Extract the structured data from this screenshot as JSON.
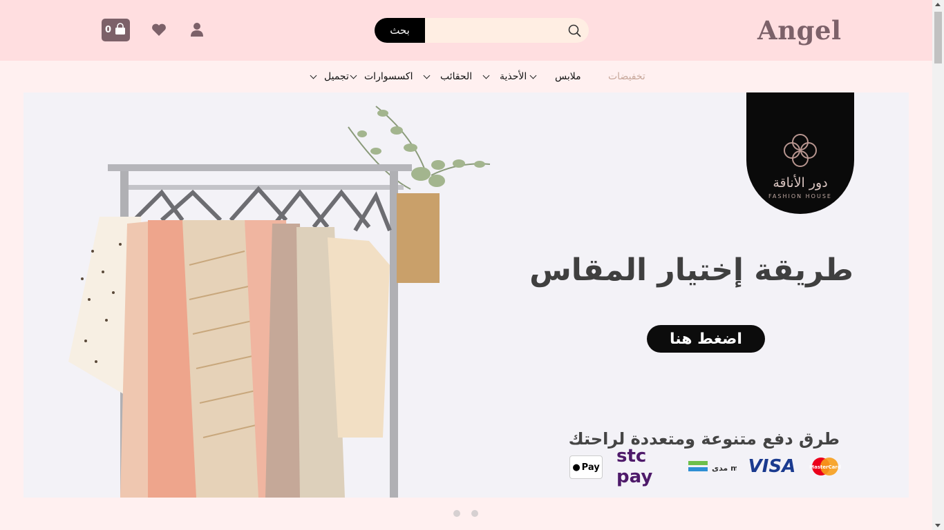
{
  "header": {
    "logo": "Angel",
    "search_button": "بحث",
    "search_placeholder": "",
    "cart_count": "0"
  },
  "nav": {
    "items": [
      {
        "label": "تخفيضات",
        "has_dropdown": false
      },
      {
        "label": "ملابس",
        "has_dropdown": true
      },
      {
        "label": "الأحذية",
        "has_dropdown": true
      },
      {
        "label": "الحقائب",
        "has_dropdown": true
      },
      {
        "label": "اكسسوارات",
        "has_dropdown": true
      },
      {
        "label": "تجميل",
        "has_dropdown": true
      }
    ]
  },
  "banner": {
    "brand_ar": "دور الأناقة",
    "brand_en": "FASHION HOUSE",
    "headline": "طريقة إختيار المقاس",
    "cta": "اضغط هنا",
    "payment_title": "طرق دفع متنوعة ومتعددة لراحتك",
    "payment_methods": [
      "MasterCard",
      "VISA",
      "مدى mada",
      "stc pay",
      "Pay"
    ]
  },
  "carousel": {
    "slides": 2
  },
  "colors": {
    "header_bg": "#ffdee0",
    "page_bg": "#fff0f0",
    "accent": "#7c6169",
    "sale": "#c7a79a"
  }
}
